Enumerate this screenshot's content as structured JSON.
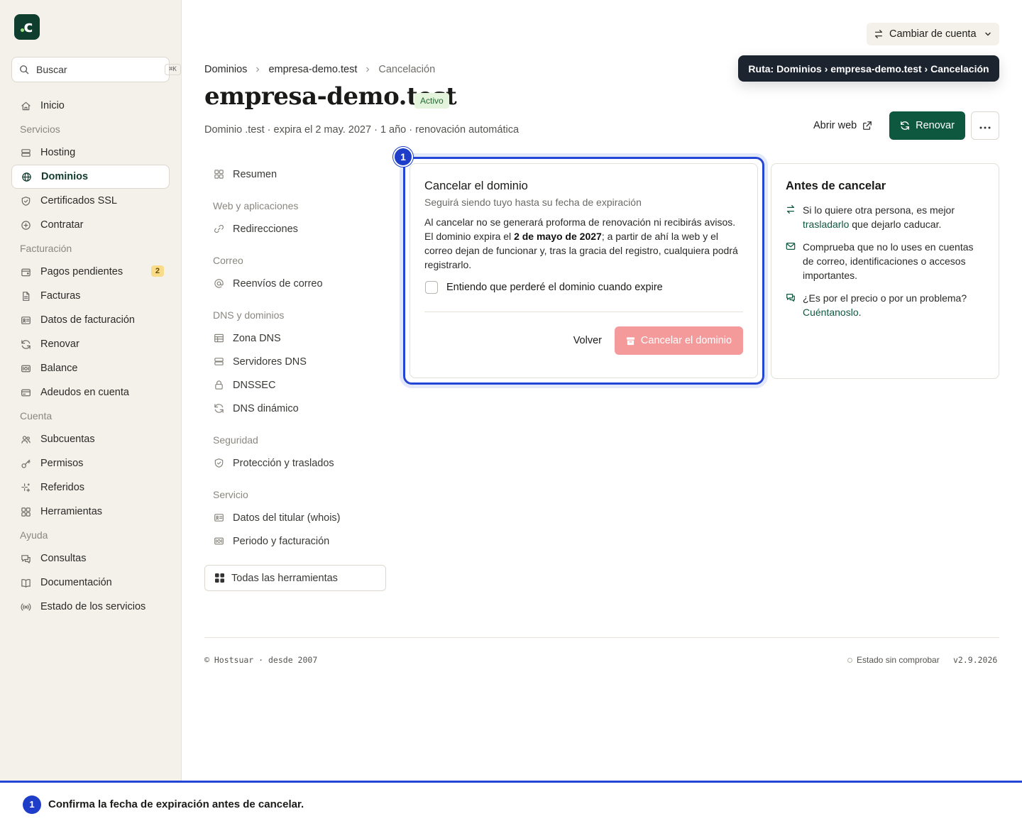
{
  "sidebar": {
    "search_placeholder": "Buscar",
    "search_shortcut": "⌘K",
    "items": [
      {
        "type": "item",
        "label": "Inicio",
        "icon": "home-icon",
        "name": "sidebar-item-inicio"
      },
      {
        "type": "section",
        "label": "Servicios"
      },
      {
        "type": "item",
        "label": "Hosting",
        "icon": "server-icon",
        "name": "sidebar-item-hosting"
      },
      {
        "type": "item",
        "label": "Dominios",
        "icon": "globe-icon",
        "name": "sidebar-item-dominios",
        "active": true
      },
      {
        "type": "item",
        "label": "Certificados SSL",
        "icon": "shield-icon",
        "name": "sidebar-item-ssl"
      },
      {
        "type": "item",
        "label": "Contratar",
        "icon": "plus-circle-icon",
        "name": "sidebar-item-contratar"
      },
      {
        "type": "section",
        "label": "Facturación"
      },
      {
        "type": "item",
        "label": "Pagos pendientes",
        "icon": "wallet-icon",
        "name": "sidebar-item-pagos",
        "badge": "2"
      },
      {
        "type": "item",
        "label": "Facturas",
        "icon": "file-icon",
        "name": "sidebar-item-facturas"
      },
      {
        "type": "item",
        "label": "Datos de facturación",
        "icon": "id-card-icon",
        "name": "sidebar-item-datos-facturacion"
      },
      {
        "type": "item",
        "label": "Renovar",
        "icon": "refresh-icon",
        "name": "sidebar-item-renovar"
      },
      {
        "type": "item",
        "label": "Balance",
        "icon": "banknote-icon",
        "name": "sidebar-item-balance"
      },
      {
        "type": "item",
        "label": "Adeudos en cuenta",
        "icon": "credit-card-icon",
        "name": "sidebar-item-adeudos"
      },
      {
        "type": "section",
        "label": "Cuenta"
      },
      {
        "type": "item",
        "label": "Subcuentas",
        "icon": "users-icon",
        "name": "sidebar-item-subcuentas"
      },
      {
        "type": "item",
        "label": "Permisos",
        "icon": "key-icon",
        "name": "sidebar-item-permisos"
      },
      {
        "type": "item",
        "label": "Referidos",
        "icon": "sparkles-icon",
        "name": "sidebar-item-referidos"
      },
      {
        "type": "item",
        "label": "Herramientas",
        "icon": "grid-icon",
        "name": "sidebar-item-herramientas"
      },
      {
        "type": "section",
        "label": "Ayuda"
      },
      {
        "type": "item",
        "label": "Consultas",
        "icon": "chat-icon",
        "name": "sidebar-item-consultas"
      },
      {
        "type": "item",
        "label": "Documentación",
        "icon": "book-icon",
        "name": "sidebar-item-documentacion"
      },
      {
        "type": "item",
        "label": "Estado de los servicios",
        "icon": "radio-icon",
        "name": "sidebar-item-estado"
      }
    ]
  },
  "topbar": {
    "switch_account": "Cambiar de cuenta",
    "tooltip": "Ruta: Dominios › empresa-demo.test › Cancelación"
  },
  "breadcrumb": [
    "Dominios",
    "empresa-demo.test",
    "Cancelación"
  ],
  "header": {
    "title": "empresa-demo.test",
    "status": "Activo",
    "subtitle": "Dominio .test · expira el 2 may. 2027 · 1 año · renovación automática",
    "open_web": "Abrir web",
    "renew": "Renovar"
  },
  "subnav": [
    {
      "type": "item",
      "label": "Resumen",
      "icon": "grid-icon",
      "name": "subnav-resumen"
    },
    {
      "type": "section",
      "label": "Web y aplicaciones"
    },
    {
      "type": "item",
      "label": "Redirecciones",
      "icon": "link-icon",
      "name": "subnav-redirecciones"
    },
    {
      "type": "section",
      "label": "Correo"
    },
    {
      "type": "item",
      "label": "Reenvíos de correo",
      "icon": "at-icon",
      "name": "subnav-reenvios"
    },
    {
      "type": "section",
      "label": "DNS y dominios"
    },
    {
      "type": "item",
      "label": "Zona DNS",
      "icon": "table-icon",
      "name": "subnav-zona-dns"
    },
    {
      "type": "item",
      "label": "Servidores DNS",
      "icon": "server-icon",
      "name": "subnav-servidores-dns"
    },
    {
      "type": "item",
      "label": "DNSSEC",
      "icon": "lock-icon",
      "name": "subnav-dnssec"
    },
    {
      "type": "item",
      "label": "DNS dinámico",
      "icon": "refresh-icon",
      "name": "subnav-dns-dinamico"
    },
    {
      "type": "section",
      "label": "Seguridad"
    },
    {
      "type": "item",
      "label": "Protección y traslados",
      "icon": "shield-icon",
      "name": "subnav-proteccion"
    },
    {
      "type": "section",
      "label": "Servicio"
    },
    {
      "type": "item",
      "label": "Datos del titular (whois)",
      "icon": "id-card-icon",
      "name": "subnav-titular"
    },
    {
      "type": "item",
      "label": "Periodo y facturación",
      "icon": "banknote-icon",
      "name": "subnav-periodo"
    }
  ],
  "all_tools": "Todas las herramientas",
  "cancel_card": {
    "step": "1",
    "title": "Cancelar el dominio",
    "subtitle": "Seguirá siendo tuyo hasta su fecha de expiración",
    "body_1": "Al cancelar no se generará proforma de renovación ni recibirás avisos. El dominio expira el ",
    "body_bold": "2 de mayo de 2027",
    "body_2": "; a partir de ahí la web y el correo dejan de funcionar y, tras la gracia del registro, cualquiera podrá registrarlo.",
    "checkbox_label": "Entiendo que perderé el dominio cuando expire",
    "back": "Volver",
    "confirm": "Cancelar el dominio"
  },
  "before_card": {
    "title": "Antes de cancelar",
    "tip1_a": "Si lo quiere otra persona, es mejor ",
    "tip1_link": "trasladarlo",
    "tip1_b": " que dejarlo caducar.",
    "tip2": "Comprueba que no lo uses en cuentas de correo, identificaciones o accesos importantes.",
    "tip3_a": "¿Es por el precio o por un problema? ",
    "tip3_link": "Cuéntanoslo",
    "tip3_b": "."
  },
  "footer": {
    "copy": "© Hostsuar · desde 2007",
    "status": "Estado sin comprobar",
    "version": "v2.9.2026"
  },
  "annotation": {
    "num": "1",
    "text": "Confirma la fecha de expiración antes de cancelar."
  }
}
